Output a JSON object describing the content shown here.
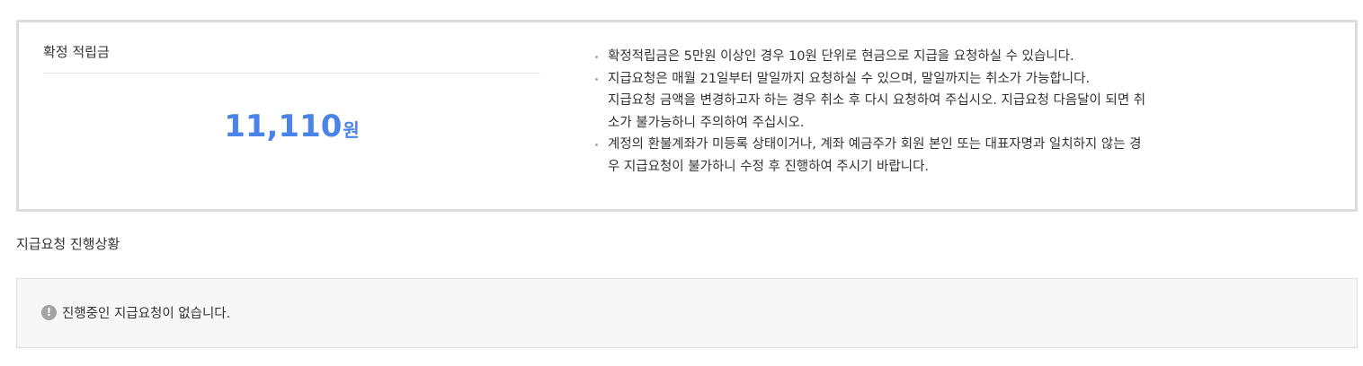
{
  "summary": {
    "title": "확정 적립금",
    "amount": "11,110",
    "unit": "원"
  },
  "notices": [
    {
      "lines": [
        "확정적립금은 5만원 이상인 경우 10원 단위로 현금으로 지급을 요청하실 수 있습니다."
      ]
    },
    {
      "lines": [
        "지급요청은 매월 21일부터 말일까지 요청하실 수 있으며, 말일까지는 취소가 가능합니다.",
        "지급요청 금액을 변경하고자 하는 경우 취소 후 다시 요청하여 주십시오. 지급요청 다음달이 되면 취",
        "소가 불가능하니 주의하여 주십시오."
      ]
    },
    {
      "lines": [
        "계정의 환불계좌가 미등록 상태이거나, 계좌 예금주가 회원 본인 또는 대표자명과 일치하지 않는 경",
        "우 지급요청이 불가하니 수정 후 진행하여 주시기 바랍니다."
      ]
    }
  ],
  "status_section": {
    "title": "지급요청 진행상황",
    "icon": "exclamation-icon",
    "icon_glyph": "!",
    "message": "진행중인 지급요청이 없습니다."
  },
  "colors": {
    "amount": "#4a84e8",
    "border": "#dcdcdc",
    "status_bg": "#f7f7f7"
  }
}
